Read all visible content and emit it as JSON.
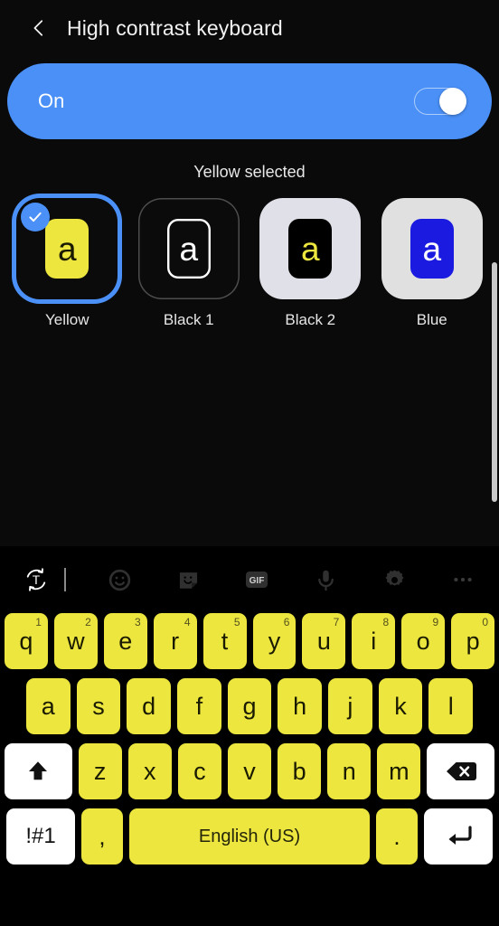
{
  "header": {
    "back_icon": "chevron-left-icon",
    "title": "High contrast keyboard"
  },
  "master_toggle": {
    "label": "On",
    "state": "on",
    "accent_color": "#4a90f7"
  },
  "status": {
    "text": "Yellow selected"
  },
  "themes": [
    {
      "label": "Yellow",
      "selected": true,
      "card_bg": "#0b0b0b",
      "key_bg": "#ece63f",
      "glyph": "a",
      "glyph_color": "#1a1a00",
      "outlined": false,
      "bordered": false
    },
    {
      "label": "Black 1",
      "selected": false,
      "card_bg": "#0b0b0b",
      "key_bg": "#0b0b0b",
      "glyph": "a",
      "glyph_color": "#ffffff",
      "outlined": true,
      "bordered": true
    },
    {
      "label": "Black 2",
      "selected": false,
      "card_bg": "#e0e0e8",
      "key_bg": "#000000",
      "glyph": "a",
      "glyph_color": "#ece63f",
      "outlined": false,
      "bordered": false
    },
    {
      "label": "Blue",
      "selected": false,
      "card_bg": "#e0e0e0",
      "key_bg": "#1a1ae0",
      "glyph": "a",
      "glyph_color": "#ffffff",
      "outlined": false,
      "bordered": false
    }
  ],
  "keyboard": {
    "toolbar": [
      {
        "name": "translate-icon",
        "label": "T"
      },
      {
        "name": "emoji-icon",
        "label": ""
      },
      {
        "name": "sticker-icon",
        "label": ""
      },
      {
        "name": "gif-icon",
        "label": "GIF"
      },
      {
        "name": "microphone-icon",
        "label": ""
      },
      {
        "name": "settings-gear-icon",
        "label": ""
      },
      {
        "name": "more-options-icon",
        "label": ""
      }
    ],
    "row1": [
      {
        "key": "q",
        "num": "1"
      },
      {
        "key": "w",
        "num": "2"
      },
      {
        "key": "e",
        "num": "3"
      },
      {
        "key": "r",
        "num": "4"
      },
      {
        "key": "t",
        "num": "5"
      },
      {
        "key": "y",
        "num": "6"
      },
      {
        "key": "u",
        "num": "7"
      },
      {
        "key": "i",
        "num": "8"
      },
      {
        "key": "o",
        "num": "9"
      },
      {
        "key": "p",
        "num": "0"
      }
    ],
    "row2": [
      "a",
      "s",
      "d",
      "f",
      "g",
      "h",
      "j",
      "k",
      "l"
    ],
    "row3_letters": [
      "z",
      "x",
      "c",
      "v",
      "b",
      "n",
      "m"
    ],
    "shift_label": "",
    "backspace_label": "",
    "symbols_label": "!#1",
    "comma_label": ",",
    "space_label": "English (US)",
    "period_label": ".",
    "enter_label": "",
    "key_color": "#ece63f",
    "func_key_color": "#ffffff"
  }
}
